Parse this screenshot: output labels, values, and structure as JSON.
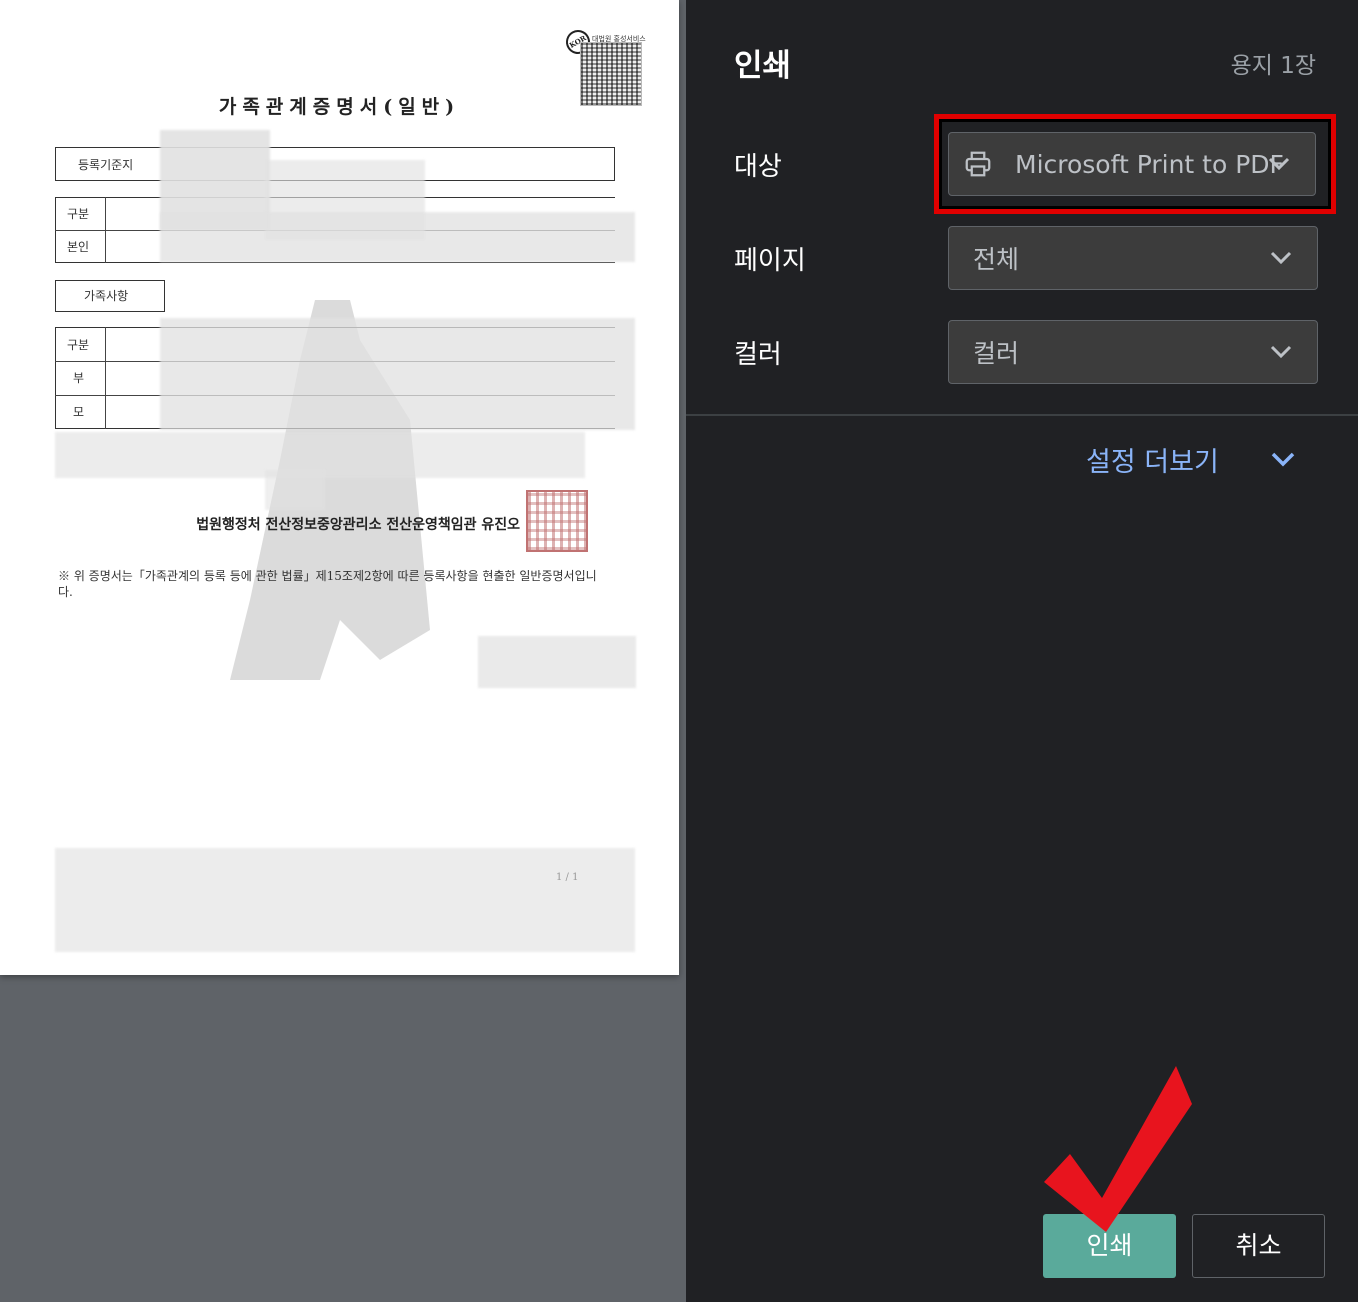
{
  "panel": {
    "title": "인쇄",
    "sheet_count": "용지 1장",
    "destination": {
      "label": "대상",
      "value": "Microsoft Print to PDF"
    },
    "pages": {
      "label": "페이지",
      "value": "전체"
    },
    "color": {
      "label": "컬러",
      "value": "컬러"
    },
    "more_settings": "설정 더보기",
    "print_button": "인쇄",
    "cancel_button": "취소"
  },
  "document": {
    "title": "가족관계증명서(일반)",
    "qr_service": "대법원 홍성서비스",
    "qr_logo": "KOR",
    "registry_label": "등록기준지",
    "self_section": {
      "rows": [
        "구분",
        "본인"
      ]
    },
    "family_label": "가족사항",
    "family_section": {
      "rows": [
        "구분",
        "부",
        "모"
      ]
    },
    "issuer": "법원행정처 전산정보중앙관리소 전산운영책임관 유진오",
    "note": "※ 위 증명서는「가족관계의 등록 등에 관한 법률」제15조제2항에 따른 등록사항을 현출한 일반증명서입니다.",
    "page_number": "1 / 1"
  },
  "colors": {
    "panel_bg": "#202124",
    "preview_bg": "#5f6368",
    "print_button_bg": "#5aaa9b",
    "link": "#8ab4f8",
    "highlight": "#e00000"
  },
  "icons": [
    "printer-icon",
    "chevron-down-icon",
    "check-mark-icon"
  ]
}
